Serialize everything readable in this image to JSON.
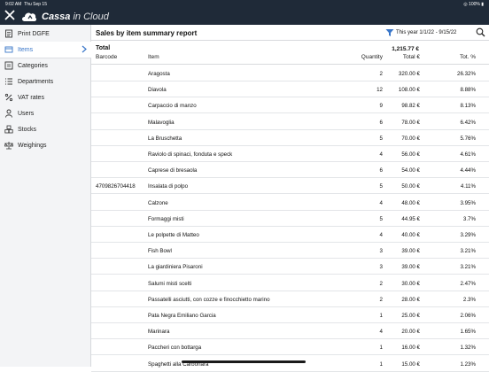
{
  "status_bar": {
    "time": "9:02 AM",
    "date": "Thu Sep 15",
    "battery": "100%"
  },
  "app": {
    "brand_bold": "Cassa",
    "brand_light": " in Cloud"
  },
  "sidebar": {
    "items": [
      {
        "label": "Print DGFE",
        "icon": "print-icon"
      },
      {
        "label": "Items",
        "icon": "items-icon",
        "active": true
      },
      {
        "label": "Categories",
        "icon": "categories-icon"
      },
      {
        "label": "Departments",
        "icon": "departments-icon"
      },
      {
        "label": "VAT rates",
        "icon": "percent-icon"
      },
      {
        "label": "Users",
        "icon": "user-icon"
      },
      {
        "label": "Stocks",
        "icon": "stocks-icon"
      },
      {
        "label": "Weighings",
        "icon": "scale-icon"
      }
    ]
  },
  "report": {
    "title": "Sales by item summary report",
    "period": "This year  1/1/22 - 9/15/22",
    "total_label": "Total",
    "total_value": "1,215.77 €",
    "columns": {
      "barcode": "Barcode",
      "item": "Item",
      "quantity": "Quantity",
      "total": "Total €",
      "pct": "Tot. %"
    },
    "rows": [
      {
        "barcode": "",
        "item": "Aragosta",
        "qty": "2",
        "total": "320.00 €",
        "pct": "26.32%"
      },
      {
        "barcode": "",
        "item": "Diavola",
        "qty": "12",
        "total": "108.00 €",
        "pct": "8.88%"
      },
      {
        "barcode": "",
        "item": "Carpaccio di manzo",
        "qty": "9",
        "total": "98.82 €",
        "pct": "8.13%"
      },
      {
        "barcode": "",
        "item": "Malavoglia",
        "qty": "6",
        "total": "78.00 €",
        "pct": "6.42%"
      },
      {
        "barcode": "",
        "item": "La Bruschetta",
        "qty": "5",
        "total": "70.00 €",
        "pct": "5.76%"
      },
      {
        "barcode": "",
        "item": "Raviolo di spinaci, fonduta e speck",
        "qty": "4",
        "total": "56.00 €",
        "pct": "4.61%"
      },
      {
        "barcode": "",
        "item": "Caprese di bresaola",
        "qty": "6",
        "total": "54.00 €",
        "pct": "4.44%"
      },
      {
        "barcode": "4709826704418",
        "item": "Insalata di polpo",
        "qty": "5",
        "total": "50.00 €",
        "pct": "4.11%"
      },
      {
        "barcode": "",
        "item": "Calzone",
        "qty": "4",
        "total": "48.00 €",
        "pct": "3.95%"
      },
      {
        "barcode": "",
        "item": "Formaggi misti",
        "qty": "5",
        "total": "44.95 €",
        "pct": "3.7%"
      },
      {
        "barcode": "",
        "item": "Le polpette di Matteo",
        "qty": "4",
        "total": "40.00 €",
        "pct": "3.29%"
      },
      {
        "barcode": "",
        "item": "Fish Bowl",
        "qty": "3",
        "total": "39.00 €",
        "pct": "3.21%"
      },
      {
        "barcode": "",
        "item": "La giardiniera Pisaroni",
        "qty": "3",
        "total": "39.00 €",
        "pct": "3.21%"
      },
      {
        "barcode": "",
        "item": "Salumi misti scelti",
        "qty": "2",
        "total": "30.00 €",
        "pct": "2.47%"
      },
      {
        "barcode": "",
        "item": "Passatelli asciutti, con cozze e finocchietto marino",
        "qty": "2",
        "total": "28.00 €",
        "pct": "2.3%"
      },
      {
        "barcode": "",
        "item": "Pata Negra Emiliano Garcia",
        "qty": "1",
        "total": "25.00 €",
        "pct": "2.06%"
      },
      {
        "barcode": "",
        "item": "Marinara",
        "qty": "4",
        "total": "20.00 €",
        "pct": "1.65%"
      },
      {
        "barcode": "",
        "item": "Paccheri con bottarga",
        "qty": "1",
        "total": "16.00 €",
        "pct": "1.32%"
      },
      {
        "barcode": "",
        "item": "Spaghetti alla Carbonara",
        "qty": "1",
        "total": "15.00 €",
        "pct": "1.23%"
      }
    ]
  },
  "colors": {
    "topbar": "#1f2a38",
    "accent": "#3a77c9",
    "sidebar_bg": "#f3f4f6"
  }
}
